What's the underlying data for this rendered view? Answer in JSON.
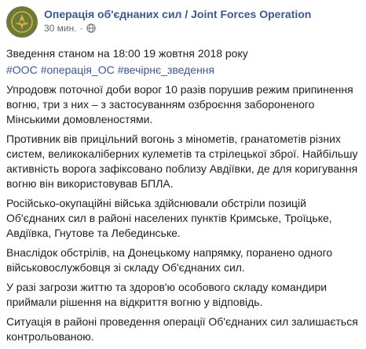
{
  "post": {
    "page_name": "Операція об'єднаних сил / Joint Forces Operation",
    "timestamp": "30 мин.",
    "separator": "·",
    "privacy_icon": "globe-icon",
    "title": "Зведення станом на 18:00 19 жовтня 2018 року",
    "hashtags": [
      "#ООС",
      "#операція_ОС",
      "#вечірнє_зведення"
    ],
    "paragraphs": [
      "Упродовж поточної доби ворог 10 разів порушив режим припинення вогню, три з них – з застосуванням озброєння забороненого Мінськими домовленостями.",
      "Противник вів прицільний вогонь з мінометів, гранатометів різних систем, великокаліберних кулеметів та стрілецької зброї. Найбільшу активність ворога зафіксовано поблизу Авдіївки, де для коригування вогню він використовував БПЛА.",
      "Російсько-окупаційні війська здійснювали обстріли позицій Об'єднаних сил в районі населених пунктів Кримське, Троїцьке, Авдіївка, Гнутове та Лебединське.",
      "Внаслідок обстрілів, на Донецькому напрямку, поранено одного військовослужбовця зі складу Об'єднаних сил.",
      "У разі загрози життю та здоров'ю особового складу командири приймали рішення на відкриття вогню у відповідь.",
      "Ситуація в районі проведення операції Об'єднаних сил залишається контрольованою."
    ],
    "colors": {
      "link": "#385898",
      "text": "#1c1e21",
      "meta": "#616770",
      "avatar_bg": "#6b7a3a",
      "avatar_emblem": "#d4b23c"
    }
  }
}
